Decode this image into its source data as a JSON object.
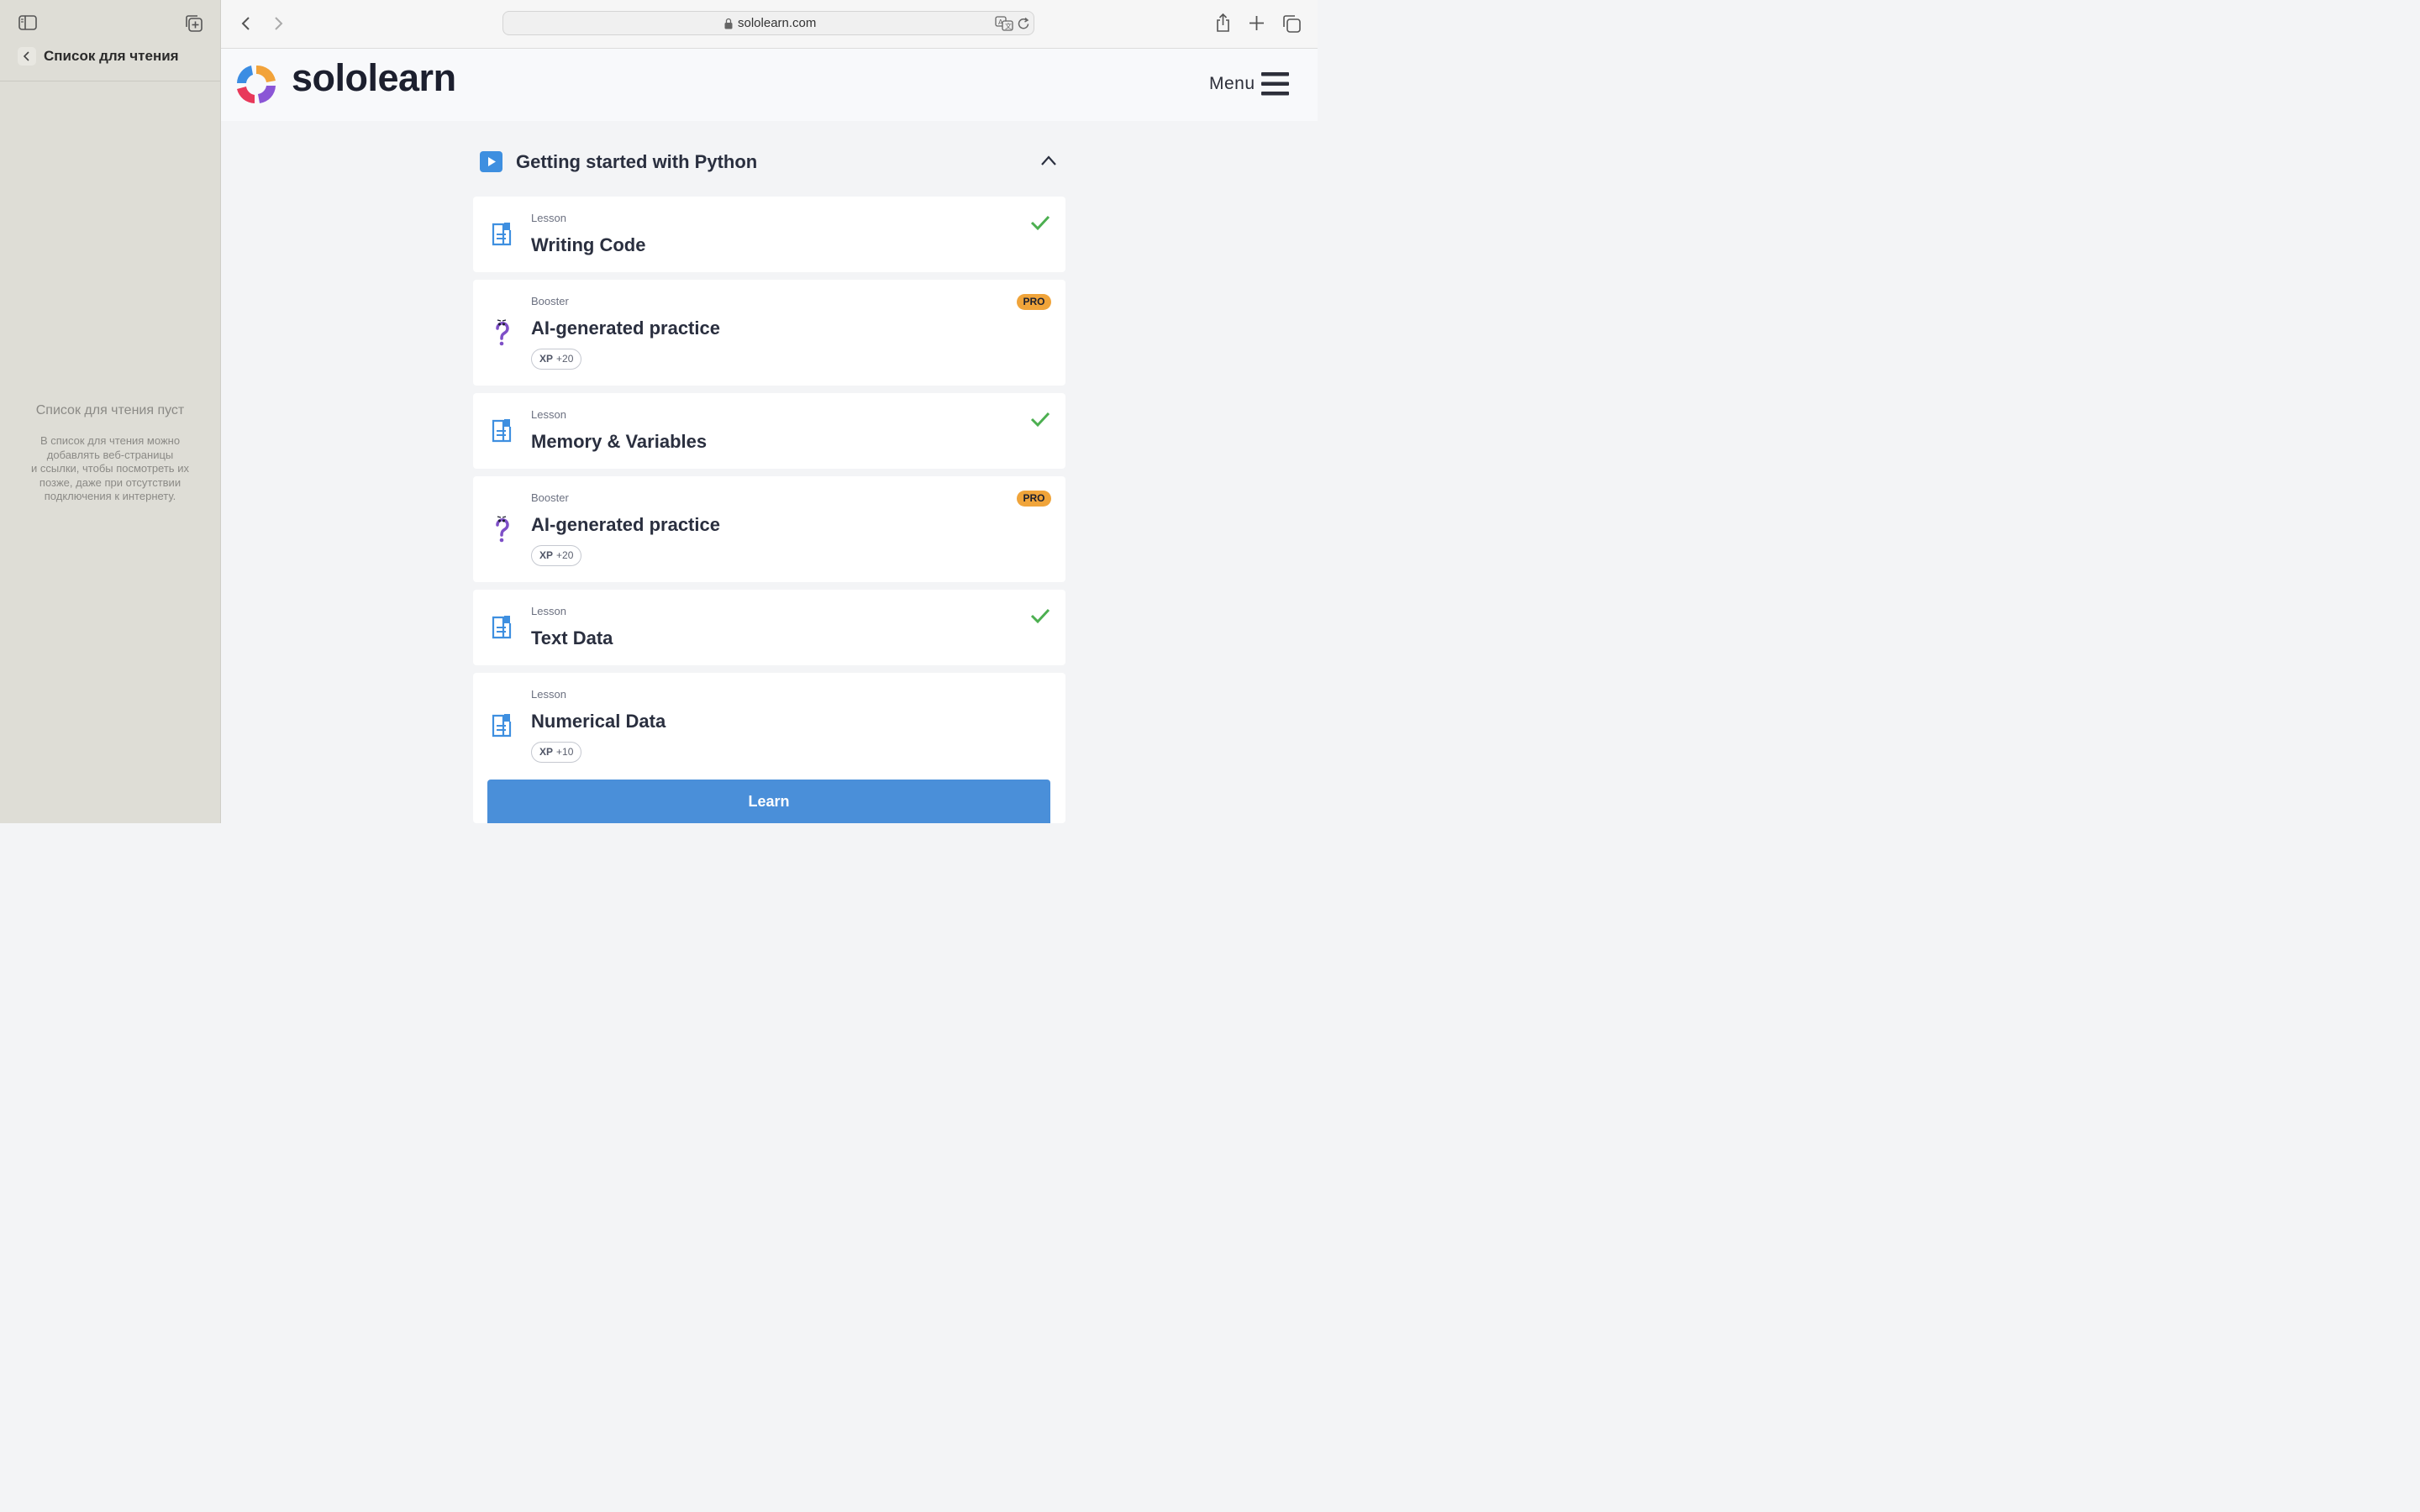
{
  "sidebar": {
    "title": "Список для чтения",
    "empty_title": "Список для чтения пуст",
    "empty_description": "В список для чтения можно\nдобавлять веб-страницы\nи ссылки, чтобы посмотреть их\nпозже, даже при отсутствии\nподключения к интернету."
  },
  "toolbar": {
    "url": "sololearn.com"
  },
  "site": {
    "logo_text": "sololearn",
    "menu_label": "Menu"
  },
  "section": {
    "title": "Getting started with Python"
  },
  "items": [
    {
      "kind": "Lesson",
      "name": "Writing Code",
      "completed": true
    },
    {
      "kind": "Booster",
      "name": "AI-generated practice",
      "badge": "PRO",
      "xp_label": "XP",
      "xp_value": "+20"
    },
    {
      "kind": "Lesson",
      "name": "Memory & Variables",
      "completed": true
    },
    {
      "kind": "Booster",
      "name": "AI-generated practice",
      "badge": "PRO",
      "xp_label": "XP",
      "xp_value": "+20"
    },
    {
      "kind": "Lesson",
      "name": "Text Data",
      "completed": true
    },
    {
      "kind": "Lesson",
      "name": "Numerical Data",
      "xp_label": "XP",
      "xp_value": "+10"
    }
  ],
  "learn_button": "Learn",
  "colors": {
    "accent_blue": "#4a8fd9",
    "check_green": "#4caf50",
    "pro_orange": "#f0a43a",
    "booster_purple": "#7e4fc7"
  }
}
